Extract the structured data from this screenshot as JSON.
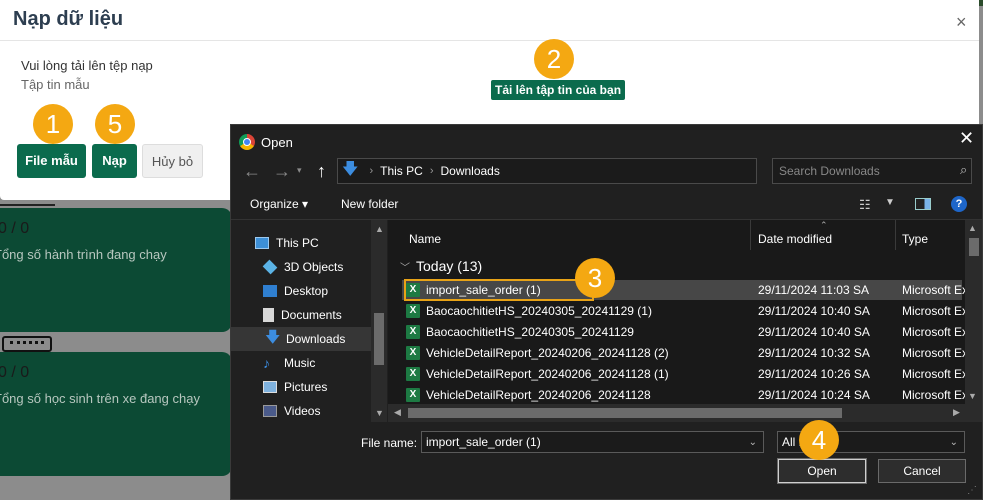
{
  "background": {
    "card1": {
      "value": "0 / 0",
      "label": "Tổng số hành trình đang chạy"
    },
    "card2": {
      "value": "0 / 0",
      "label": "Tổng số học sinh trên xe đang chạy"
    }
  },
  "modal": {
    "title": "Nạp dữ liệu",
    "close_glyph": "×",
    "prompt": "Vui lòng tải lên tệp nạp",
    "template_label": "Tập tin mẫu",
    "upload_button": "Tải lên tập tin của bạn",
    "sample_button": "File mẫu",
    "import_button": "Nạp",
    "cancel_button": "Hủy bỏ",
    "accent_color": "#0b6b4d"
  },
  "badges": [
    "1",
    "2",
    "3",
    "4",
    "5"
  ],
  "badge_color": "#f4a812",
  "dialog": {
    "title": "Open",
    "close_glyph": "✕",
    "breadcrumb": [
      "This PC",
      "Downloads"
    ],
    "search_placeholder": "Search Downloads",
    "toolbar": {
      "organize": "Organize ▾",
      "new_folder": "New folder"
    },
    "sidebar": [
      {
        "label": "This PC",
        "icon": "pc-icon"
      },
      {
        "label": "3D Objects",
        "icon": "cube-icon"
      },
      {
        "label": "Desktop",
        "icon": "desktop-icon"
      },
      {
        "label": "Documents",
        "icon": "documents-icon"
      },
      {
        "label": "Downloads",
        "icon": "downloads-icon"
      },
      {
        "label": "Music",
        "icon": "music-icon"
      },
      {
        "label": "Pictures",
        "icon": "pictures-icon"
      },
      {
        "label": "Videos",
        "icon": "videos-icon"
      }
    ],
    "columns": [
      "Name",
      "Date modified",
      "Type"
    ],
    "group": "Today (13)",
    "files": [
      {
        "name": "import_sale_order (1)",
        "date": "29/11/2024 11:03 SA",
        "type": "Microsoft Ex"
      },
      {
        "name": "BaocaochitietHS_20240305_20241129 (1)",
        "date": "29/11/2024 10:40 SA",
        "type": "Microsoft Ex"
      },
      {
        "name": "BaocaochitietHS_20240305_20241129",
        "date": "29/11/2024 10:40 SA",
        "type": "Microsoft Ex"
      },
      {
        "name": "VehicleDetailReport_20240206_20241128 (2)",
        "date": "29/11/2024 10:32 SA",
        "type": "Microsoft Ex"
      },
      {
        "name": "VehicleDetailReport_20240206_20241128 (1)",
        "date": "29/11/2024 10:26 SA",
        "type": "Microsoft Ex"
      },
      {
        "name": "VehicleDetailReport_20240206_20241128",
        "date": "29/11/2024 10:24 SA",
        "type": "Microsoft Ex"
      }
    ],
    "file_name_label": "File name:",
    "file_name_value": "import_sale_order (1)",
    "file_type_value": "All F",
    "open_button": "Open",
    "cancel_button": "Cancel"
  }
}
